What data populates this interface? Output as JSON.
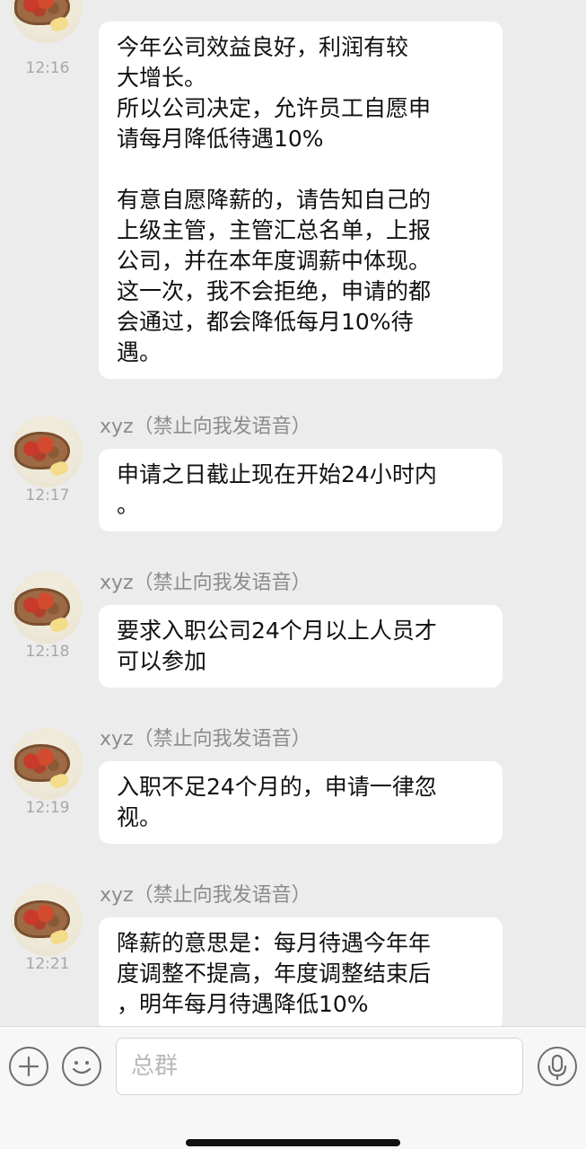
{
  "messages": [
    {
      "time": "12:16",
      "sender": "",
      "paragraphs": [
        "今年公司效益良好，利润有较\n大增长。\n所以公司决定，允许员工自愿申\n请每月降低待遇10%",
        "有意自愿降薪的，请告知自己的\n上级主管，主管汇总名单，上报\n公司，并在本年度调薪中体现。\n这一次，我不会拒绝，申请的都\n会通过，都会降低每月10%待\n遇。"
      ]
    },
    {
      "time": "12:17",
      "sender": "xyz（禁止向我发语音）",
      "paragraphs": [
        "申请之日截止现在开始24小时内\n。"
      ]
    },
    {
      "time": "12:18",
      "sender": "xyz（禁止向我发语音）",
      "paragraphs": [
        "要求入职公司24个月以上人员才\n可以参加"
      ]
    },
    {
      "time": "12:19",
      "sender": "xyz（禁止向我发语音）",
      "paragraphs": [
        "入职不足24个月的，申请一律忽\n视。"
      ]
    },
    {
      "time": "12:21",
      "sender": "xyz（禁止向我发语音）",
      "paragraphs": [
        "降薪的意思是：每月待遇今年年\n度调整不提高，年度调整结束后\n，明年每月待遇降低10%"
      ]
    }
  ],
  "input_bar": {
    "placeholder": "总群",
    "icons": [
      "plus-icon",
      "emoji-icon",
      "microphone-icon"
    ]
  },
  "colors": {
    "background": "#ececec",
    "bubble": "#ffffff",
    "time_text": "#a7a7a7",
    "sender_text": "#8c8c8c"
  }
}
